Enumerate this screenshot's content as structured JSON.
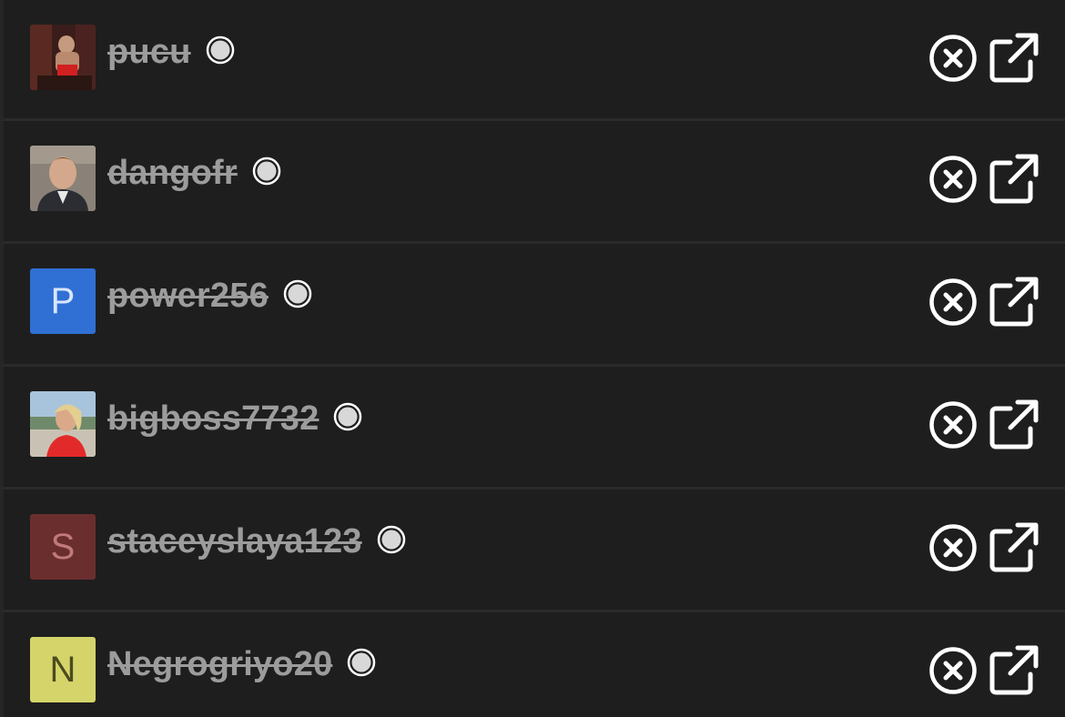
{
  "users": [
    {
      "username": "pucu",
      "avatar_type": "photo",
      "avatar_icon": "avatar-photo-icon"
    },
    {
      "username": "dangofr",
      "avatar_type": "photo",
      "avatar_icon": "avatar-photo-icon"
    },
    {
      "username": "power256",
      "avatar_type": "letter",
      "avatar_letter": "P",
      "avatar_bg": "#3070d4",
      "avatar_fg": "#d9e6ff"
    },
    {
      "username": "bigboss7732",
      "avatar_type": "photo",
      "avatar_icon": "avatar-photo-icon"
    },
    {
      "username": "staceyslaya123",
      "avatar_type": "letter",
      "avatar_letter": "S",
      "avatar_bg": "#6b2e2e",
      "avatar_fg": "#c07a7a"
    },
    {
      "username": "Negrogriyo20",
      "avatar_type": "letter",
      "avatar_letter": "N",
      "avatar_bg": "#d4d46a",
      "avatar_fg": "#4b4b1e"
    }
  ],
  "icons": {
    "status": "radio-dot-icon",
    "remove": "close-circle-icon",
    "open": "external-link-icon"
  },
  "colors": {
    "background": "#1e1e1e",
    "username": "#9c9c9c",
    "icon": "#ffffff",
    "status_dot": "#d8d8d8"
  }
}
